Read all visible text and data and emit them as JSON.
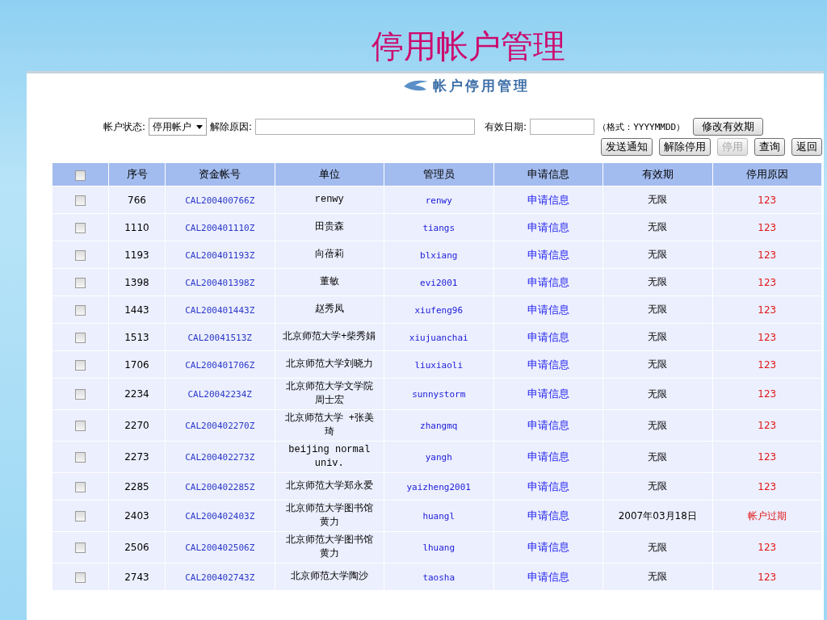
{
  "slide_title": "停用帐户管理",
  "panel_title": "帐户停用管理",
  "form": {
    "status_label": "帐户状态:",
    "status_value": "停用帐户",
    "reason_label": "解除原因:",
    "date_label": "有效日期:",
    "format_hint": "（格式：YYYYMMDD）"
  },
  "buttons_row1": [
    {
      "label": "修改有效期",
      "disabled": false
    }
  ],
  "buttons_row2": [
    {
      "label": "发送通知",
      "disabled": false
    },
    {
      "label": "解除停用",
      "disabled": false
    },
    {
      "label": "停用",
      "disabled": true
    },
    {
      "label": "查询",
      "disabled": false
    },
    {
      "label": "返回",
      "disabled": false
    }
  ],
  "table": {
    "header_checked": false,
    "columns": [
      "序号",
      "资金帐号",
      "单位",
      "管理员",
      "申请信息",
      "有效期",
      "停用原因"
    ],
    "rows": [
      {
        "checked": false,
        "no": "766",
        "account": "CAL200400766Z",
        "unit": "renwy",
        "admin": "renwy",
        "info": "申请信息",
        "validity": "无限",
        "reason": "123"
      },
      {
        "checked": false,
        "no": "1110",
        "account": "CAL200401110Z",
        "unit": "田贵森",
        "admin": "tiangs",
        "info": "申请信息",
        "validity": "无限",
        "reason": "123"
      },
      {
        "checked": false,
        "no": "1193",
        "account": "CAL200401193Z",
        "unit": "向蓓莉",
        "admin": "blxiang",
        "info": "申请信息",
        "validity": "无限",
        "reason": "123"
      },
      {
        "checked": false,
        "no": "1398",
        "account": "CAL200401398Z",
        "unit": "董敏",
        "admin": "evi2001",
        "info": "申请信息",
        "validity": "无限",
        "reason": "123"
      },
      {
        "checked": false,
        "no": "1443",
        "account": "CAL200401443Z",
        "unit": "赵秀凤",
        "admin": "xiufeng96",
        "info": "申请信息",
        "validity": "无限",
        "reason": "123"
      },
      {
        "checked": false,
        "no": "1513",
        "account": "CAL20041513Z",
        "unit": "北京师范大学+柴秀娟",
        "admin": "xiujuanchai",
        "info": "申请信息",
        "validity": "无限",
        "reason": "123"
      },
      {
        "checked": false,
        "no": "1706",
        "account": "CAL200401706Z",
        "unit": "北京师范大学刘晓力",
        "admin": "liuxiaoli",
        "info": "申请信息",
        "validity": "无限",
        "reason": "123"
      },
      {
        "checked": false,
        "no": "2234",
        "account": "CAL20042234Z",
        "unit": "北京师范大学文学院周士宏",
        "admin": "sunnystorm",
        "info": "申请信息",
        "validity": "无限",
        "reason": "123"
      },
      {
        "checked": false,
        "no": "2270",
        "account": "CAL200402270Z",
        "unit": "北京师范大学 +张美琦",
        "admin": "zhangmq",
        "info": "申请信息",
        "validity": "无限",
        "reason": "123"
      },
      {
        "checked": false,
        "no": "2273",
        "account": "CAL200402273Z",
        "unit": "beijing normal univ.",
        "admin": "yangh",
        "info": "申请信息",
        "validity": "无限",
        "reason": "123"
      },
      {
        "checked": false,
        "no": "2285",
        "account": "CAL200402285Z",
        "unit": "北京师范大学郑永爱",
        "admin": "yaizheng2001",
        "info": "申请信息",
        "validity": "无限",
        "reason": "123"
      },
      {
        "checked": false,
        "no": "2403",
        "account": "CAL200402403Z",
        "unit": "北京师范大学图书馆黄力",
        "admin": "huangl",
        "info": "申请信息",
        "validity": "2007年03月18日",
        "reason": "帐户过期"
      },
      {
        "checked": false,
        "no": "2506",
        "account": "CAL200402506Z",
        "unit": "北京师范大学图书馆黄力",
        "admin": "lhuang",
        "info": "申请信息",
        "validity": "无限",
        "reason": "123"
      },
      {
        "checked": false,
        "no": "2743",
        "account": "CAL200402743Z",
        "unit": "北京师范大学陶沙",
        "admin": "taosha",
        "info": "申请信息",
        "validity": "无限",
        "reason": "123"
      }
    ]
  }
}
